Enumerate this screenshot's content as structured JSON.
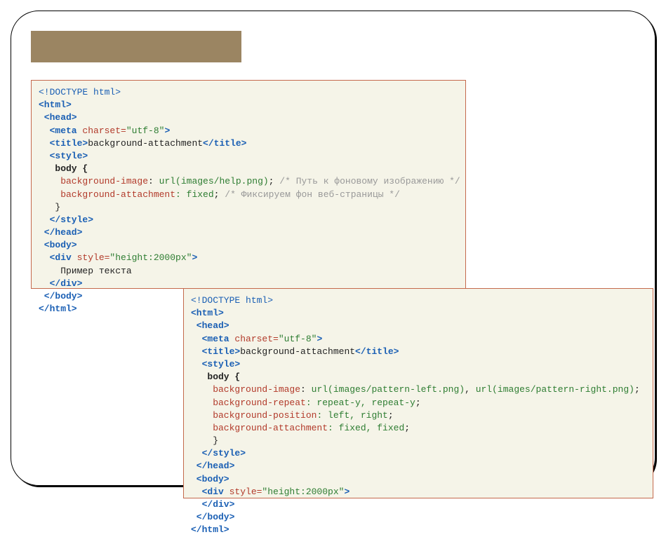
{
  "code1": {
    "l1a": "<!DOCTYPE html>",
    "l2a": "<html>",
    "l3a": " <head>",
    "l4a": "  <meta ",
    "l4b": "charset=",
    "l4c": "\"utf-8\"",
    "l4d": ">",
    "l5a": "  <title>",
    "l5b": "background-attachment",
    "l5c": "</title>",
    "l6a": "  <style>",
    "l7a": "   body {",
    "l8a": "    background-image",
    "l8b": ": ",
    "l8c": "url",
    "l8d": "(images/help.png)",
    "l8e": ";",
    "l8f": " /* Путь к фоновому изображению */",
    "l9a": "    background-attachment",
    "l9b": ": fixed",
    "l9c": ";",
    "l9d": " /* Фиксируем фон веб-страницы */",
    "l10a": "   }",
    "l11a": "  </style>",
    "l12a": " </head>",
    "l13a": " <body>",
    "l14a": "  <div ",
    "l14b": "style=",
    "l14c": "\"height:2000px\"",
    "l14d": ">",
    "l15a": "    Пример текста",
    "l16a": "  </div>",
    "l17a": " </body>",
    "l18a": "</html>"
  },
  "code2": {
    "l1a": "<!DOCTYPE html>",
    "l2a": "<html>",
    "l3a": " <head>",
    "l4a": "  <meta ",
    "l4b": "charset=",
    "l4c": "\"utf-8\"",
    "l4d": ">",
    "l5a": "  <title>",
    "l5b": "background-attachment",
    "l5c": "</title>",
    "l6a": "  <style>",
    "l7a": "   body {",
    "l8a": "    background-image",
    "l8b": ": ",
    "l8c": "url",
    "l8d": "(images/pattern-left.png)",
    "l8e": ", ",
    "l8f": "url",
    "l8g": "(images/pattern-right.png)",
    "l8h": ";",
    "l9a": "    background-repeat",
    "l9b": ": repeat-y, repeat-y",
    "l9c": ";",
    "l10a": "    background-position",
    "l10b": ": left, right",
    "l10c": ";",
    "l11a": "    background-attachment",
    "l11b": ": fixed, fixed",
    "l11c": ";",
    "l12a": "    }",
    "l13a": "  </style>",
    "l14a": " </head>",
    "l15a": " <body>",
    "l16a": "  <div ",
    "l16b": "style=",
    "l16c": "\"height:2000px\"",
    "l16d": ">",
    "l17a": "  </div>",
    "l18a": " </body>",
    "l19a": "</html>"
  }
}
